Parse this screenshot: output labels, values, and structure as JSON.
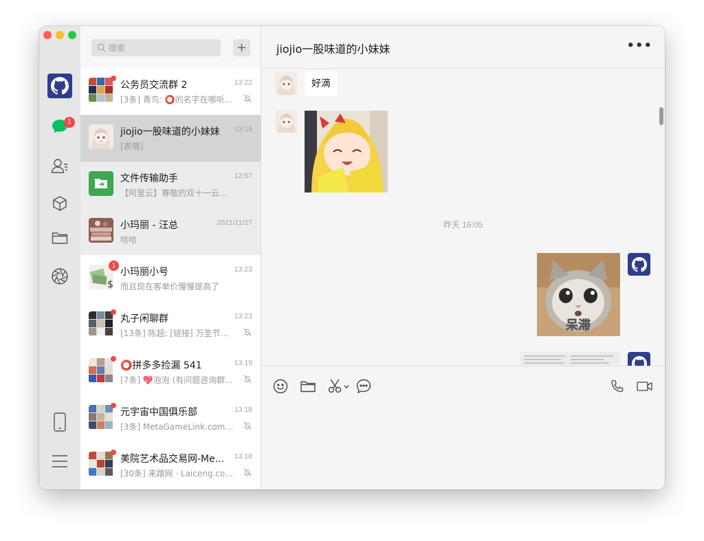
{
  "window": {
    "sidebar": {
      "chats_badge": "1"
    },
    "search": {
      "placeholder": "搜索"
    },
    "add_label": "+",
    "chats": [
      {
        "name": "公务员交流群 2",
        "time": "13:22",
        "preview": "[3条] 青鸟: ⭕的名字在哪听...",
        "muted": true,
        "unread_dot": true
      },
      {
        "name": "jiojio一股味道的小妹妹",
        "time": "13:19",
        "preview": "[表情]",
        "selected": true
      },
      {
        "name": "文件传输助手",
        "time": "12:57",
        "preview": "【阿里云】尊敬的双十一云小宝..."
      },
      {
        "name": "小玛丽 - 汪总",
        "time": "2021/11/27",
        "preview": "哈哈"
      },
      {
        "name": "小玛丽小号",
        "time": "13:23",
        "preview": "而且现在客单价慢慢提高了",
        "badge": "1"
      },
      {
        "name": "丸子闲聊群",
        "time": "13:23",
        "preview": "[13条] 陈超: [链接] 万圣节头...",
        "muted": true,
        "unread_dot": true
      },
      {
        "name": "⭕拼多多捡漏 541",
        "time": "13:19",
        "preview": "[7条] 💖泡泡 (有问题咨询群...",
        "muted": true,
        "unread_dot": true
      },
      {
        "name": "元宇宙中国俱乐部",
        "time": "13:18",
        "preview": "[3条] MetaGameLink.com: nf...",
        "muted": true,
        "unread_dot": true
      },
      {
        "name": "美院艺术品交易网-Me...",
        "time": "13:18",
        "preview": "[30条] 来蹭网 · Laiceng.com:...",
        "muted": true,
        "unread_dot": true
      }
    ]
  },
  "chat": {
    "title": "jiojio一股味道的小妹妹",
    "more_label": "•••",
    "messages": {
      "text_bubble": "好滴",
      "timestamp": "昨天 16:05",
      "cat_caption": "呆滞"
    }
  },
  "colors": {
    "accent_green": "#07c160",
    "badge_red": "#f04848",
    "selected_row": "#d4d4d4",
    "github_avatar": "#2f3d8f"
  },
  "icons": [
    "github-avatar-icon",
    "chat-bubble-icon",
    "contacts-icon",
    "cube-icon",
    "folder-icon",
    "aperture-icon",
    "phone-device-icon",
    "menu-icon",
    "search-icon",
    "emoji-icon",
    "scissors-icon",
    "message-icon",
    "call-icon",
    "video-icon",
    "bell-off-icon"
  ]
}
